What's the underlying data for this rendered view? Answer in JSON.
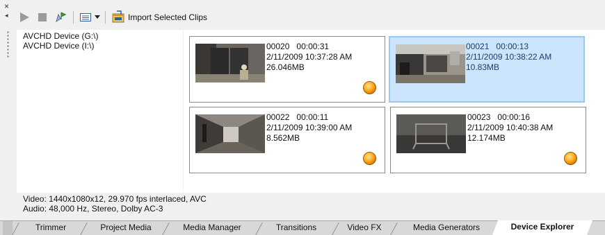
{
  "toolbar": {
    "import_label": "Import Selected Clips",
    "icons": [
      "play-icon",
      "stop-icon",
      "eject-icon",
      "view-icon",
      "dropdown-icon",
      "import-icon"
    ]
  },
  "tree": {
    "items": [
      {
        "label": "AVCHD Device (G:\\)"
      },
      {
        "label": "AVCHD Device (I:\\)"
      }
    ]
  },
  "clips": [
    {
      "id": "00020",
      "duration": "00:00:31",
      "date": "2/11/2009 10:37:28 AM",
      "size": "26.046MB",
      "selected": false,
      "has_badge": true
    },
    {
      "id": "00021",
      "duration": "00:00:13",
      "date": "2/11/2009 10:38:22 AM",
      "size": "10.83MB",
      "selected": true,
      "has_badge": false
    },
    {
      "id": "00022",
      "duration": "00:00:11",
      "date": "2/11/2009 10:39:00 AM",
      "size": "8.562MB",
      "selected": false,
      "has_badge": true
    },
    {
      "id": "00023",
      "duration": "00:00:16",
      "date": "2/11/2009 10:40:38 AM",
      "size": "12.174MB",
      "selected": false,
      "has_badge": true
    }
  ],
  "status": {
    "video": "Video: 1440x1080x12, 29.970 fps interlaced, AVC",
    "audio": "Audio: 48,000 Hz, Stereo, Dolby AC-3"
  },
  "tabs": [
    {
      "label": "Trimmer",
      "active": false
    },
    {
      "label": "Project Media",
      "active": false
    },
    {
      "label": "Media Manager",
      "active": false
    },
    {
      "label": "Transitions",
      "active": false
    },
    {
      "label": "Video FX",
      "active": false
    },
    {
      "label": "Media Generators",
      "active": false
    },
    {
      "label": "Device Explorer",
      "active": true
    }
  ],
  "colors": {
    "selection_bg": "#cce4fc",
    "selection_border": "#99c9ef",
    "badge": "#ffa21a"
  }
}
